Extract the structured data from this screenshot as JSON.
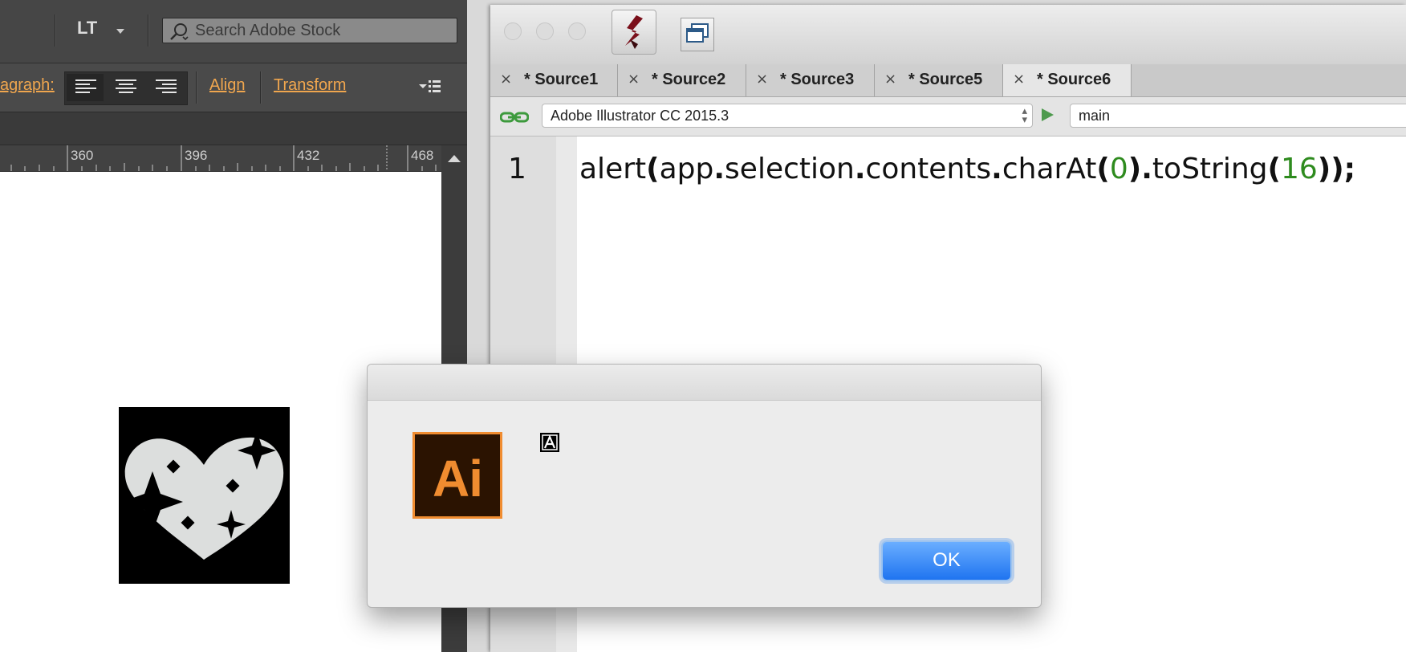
{
  "illustrator": {
    "workspace_label": "LT",
    "search": {
      "placeholder": "Search Adobe Stock"
    },
    "control_bar": {
      "paragraph_label": "agraph:",
      "align_label": "Align",
      "transform_label": "Transform"
    },
    "ruler": {
      "labels": [
        "360",
        "396",
        "432",
        "468"
      ]
    },
    "colors": {
      "panel_bg": "#3c3c3c",
      "link_orange": "#f0a64e",
      "canvas": "#ffffff"
    }
  },
  "estk": {
    "tabs": [
      {
        "label": "* Source1",
        "active": false
      },
      {
        "label": "* Source2",
        "active": false
      },
      {
        "label": "* Source3",
        "active": false
      },
      {
        "label": "* Source5",
        "active": false
      },
      {
        "label": "* Source6",
        "active": true
      }
    ],
    "tab_close_glyph": "×",
    "target_app": "Adobe Illustrator CC 2015.3",
    "target_function": "main",
    "editor": {
      "line_number": "1",
      "code": {
        "t1": "alert",
        "t2": "(",
        "t3": "app",
        "t4": ".",
        "t5": "selection",
        "t6": ".",
        "t7": "contents",
        "t8": ".",
        "t9": "charAt",
        "t10": "(",
        "t11": "0",
        "t12": ")",
        "t13": ".",
        "t14": "toString",
        "t15": "(",
        "t16": "16",
        "t17": "));"
      }
    },
    "colors": {
      "number_green": "#2e8b1e"
    }
  },
  "alert": {
    "app_icon_label": "Ai",
    "ok_label": "OK",
    "colors": {
      "icon_bg": "#2b1301",
      "icon_orange": "#f08c30",
      "ok_blue": "#1f74f0"
    }
  }
}
